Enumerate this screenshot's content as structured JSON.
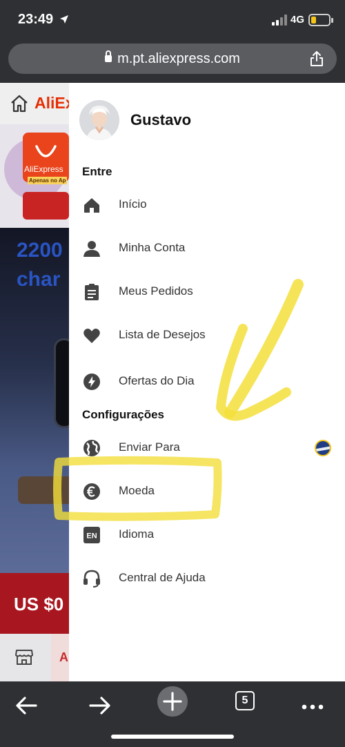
{
  "status_bar": {
    "time": "23:49",
    "network": "4G"
  },
  "browser": {
    "url": "m.pt.aliexpress.com"
  },
  "background_page": {
    "brand": "AliEx",
    "app_label": "AliExpress",
    "app_sub": "Apenas no Ap",
    "hero_text_1": "2200",
    "hero_text_2": "char",
    "price": "US $0",
    "tab_partial": "A"
  },
  "drawer": {
    "username": "Gustavo",
    "section_enter": "Entre",
    "enter_items": [
      {
        "label": "Início",
        "icon": "home-icon"
      },
      {
        "label": "Minha Conta",
        "icon": "person-icon"
      },
      {
        "label": "Meus Pedidos",
        "icon": "clipboard-icon"
      },
      {
        "label": "Lista de Desejos",
        "icon": "heart-icon"
      },
      {
        "label": "Ofertas do Dia",
        "icon": "flash-icon"
      }
    ],
    "section_settings": "Configurações",
    "settings_items": [
      {
        "label": "Enviar Para",
        "icon": "globe-icon"
      },
      {
        "label": "Moeda",
        "icon": "euro-icon"
      },
      {
        "label": "Idioma",
        "icon": "language-en-icon",
        "badge": "EN"
      },
      {
        "label": "Central de Ajuda",
        "icon": "headset-icon"
      }
    ]
  },
  "toolbar": {
    "tab_count": "5"
  },
  "colors": {
    "brand_red": "#e62e04",
    "highlight_yellow": "#f3df3b",
    "chrome_dark": "#2f3033"
  }
}
